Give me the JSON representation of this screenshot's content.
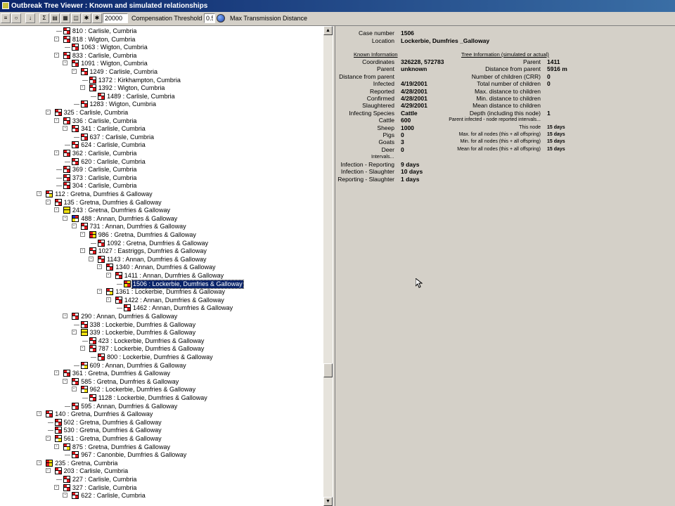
{
  "window": {
    "title": "Outbreak Tree Viewer : Known and simulated relationships"
  },
  "toolbar": {
    "distance_value": "20000",
    "comp_label": "Compensation Threshold",
    "comp_value": "0.5",
    "max_label": "Max Transmission Distance",
    "icons": [
      "tree-view-icon",
      "refresh-icon",
      "sort-icon",
      "sigma-icon",
      "chart-icon",
      "export-icon",
      "map-icon",
      "group-icon",
      "group-icon",
      "group-icon"
    ]
  },
  "colors": {
    "red": "#e0191f",
    "yellow": "#f0e010",
    "blue": "#1a33c8",
    "white": "#ffffff",
    "selection": "#0a246a"
  },
  "tree": [
    {
      "depth": 3,
      "toggle": "",
      "icon": "rwwr",
      "label": "810 : Carlisle, Cumbria"
    },
    {
      "depth": 3,
      "toggle": "-",
      "icon": "rwwr",
      "label": "818 : Wigton, Cumbria"
    },
    {
      "depth": 4,
      "toggle": "",
      "icon": "rwwr",
      "label": "1063 : Wigton, Cumbria"
    },
    {
      "depth": 3,
      "toggle": "-",
      "icon": "rwwr",
      "label": "833 : Carlisle, Cumbria"
    },
    {
      "depth": 4,
      "toggle": "-",
      "icon": "rwwr",
      "label": "1091 : Wigton, Cumbria"
    },
    {
      "depth": 5,
      "toggle": "-",
      "icon": "rwwr",
      "label": "1249 : Carlisle, Cumbria"
    },
    {
      "depth": 6,
      "toggle": "",
      "icon": "rwwr",
      "label": "1372 : Kirkhampton, Cumbria"
    },
    {
      "depth": 6,
      "toggle": "-",
      "icon": "rwwr",
      "label": "1392 : Wigton, Cumbria"
    },
    {
      "depth": 7,
      "toggle": "",
      "icon": "rwwr",
      "label": "1489 : Carlisle, Cumbria"
    },
    {
      "depth": 5,
      "toggle": "",
      "icon": "rwwr",
      "label": "1283 : Wigton, Cumbria"
    },
    {
      "depth": 2,
      "toggle": "-",
      "icon": "rwwr",
      "label": "325 : Carlisle, Cumbria"
    },
    {
      "depth": 3,
      "toggle": "-",
      "icon": "rwwr",
      "label": "336 : Carlisle, Cumbria"
    },
    {
      "depth": 4,
      "toggle": "-",
      "icon": "rwwr",
      "label": "341 : Carlisle, Cumbria"
    },
    {
      "depth": 5,
      "toggle": "",
      "icon": "rwwr",
      "label": "637 : Carlisle, Cumbria"
    },
    {
      "depth": 4,
      "toggle": "",
      "icon": "rwwr",
      "label": "624 : Carlisle, Cumbria"
    },
    {
      "depth": 3,
      "toggle": "-",
      "icon": "rwwr",
      "label": "362 : Carlisle, Cumbria"
    },
    {
      "depth": 4,
      "toggle": "",
      "icon": "rwwr",
      "label": "620 : Carlisle, Cumbria"
    },
    {
      "depth": 3,
      "toggle": "",
      "icon": "rwwr",
      "label": "369 : Carlisle, Cumbria"
    },
    {
      "depth": 3,
      "toggle": "",
      "icon": "rwwr",
      "label": "373 : Carlisle, Cumbria"
    },
    {
      "depth": 3,
      "toggle": "",
      "icon": "rwwr",
      "label": "304 : Carlisle, Cumbria"
    },
    {
      "depth": 1,
      "toggle": "-",
      "icon": "rwwy",
      "label": "112 : Gretna, Dumfries & Galloway"
    },
    {
      "depth": 2,
      "toggle": "-",
      "icon": "rwwr",
      "label": "135 : Gretna, Dumfries & Galloway"
    },
    {
      "depth": 3,
      "toggle": "-",
      "icon": "yyyy",
      "label": "243 : Gretna, Dumfries & Galloway"
    },
    {
      "depth": 4,
      "toggle": "-",
      "icon": "bryw",
      "label": "488 : Annan, Dumfries & Galloway"
    },
    {
      "depth": 5,
      "toggle": "-",
      "icon": "rwwr",
      "label": "731 : Annan, Dumfries & Galloway"
    },
    {
      "depth": 6,
      "toggle": "-",
      "icon": "ryry",
      "label": "986 : Gretna, Dumfries & Galloway"
    },
    {
      "depth": 7,
      "toggle": "",
      "icon": "rwwr",
      "label": "1092 : Gretna, Dumfries & Galloway"
    },
    {
      "depth": 6,
      "toggle": "-",
      "icon": "rwwr",
      "label": "1027 : Eastriggs, Dumfries & Galloway"
    },
    {
      "depth": 7,
      "toggle": "-",
      "icon": "rwwr",
      "label": "1143 : Annan, Dumfries & Galloway"
    },
    {
      "depth": 8,
      "toggle": "-",
      "icon": "rwwr",
      "label": "1340 : Annan, Dumfries & Galloway"
    },
    {
      "depth": 9,
      "toggle": "-",
      "icon": "rwwr",
      "label": "1411 : Annan, Dumfries & Galloway"
    },
    {
      "depth": 10,
      "toggle": "",
      "icon": "ryyr",
      "label": "1506 : Lockerbie, Dumfries & Galloway",
      "selected": true
    },
    {
      "depth": 8,
      "toggle": "-",
      "icon": "rwwy",
      "label": "1361 : Lockerbie, Dumfries & Galloway"
    },
    {
      "depth": 9,
      "toggle": "-",
      "icon": "rwwr",
      "label": "1422 : Annan, Dumfries & Galloway"
    },
    {
      "depth": 10,
      "toggle": "",
      "icon": "rwwr",
      "label": "1462 : Annan, Dumfries & Galloway"
    },
    {
      "depth": 4,
      "toggle": "-",
      "icon": "rwwr",
      "label": "290 : Annan, Dumfries & Galloway"
    },
    {
      "depth": 5,
      "toggle": "",
      "icon": "rwwr",
      "label": "338 : Lockerbie, Dumfries & Galloway"
    },
    {
      "depth": 5,
      "toggle": "-",
      "icon": "yyyy",
      "label": "339 : Lockerbie, Dumfries & Galloway"
    },
    {
      "depth": 6,
      "toggle": "",
      "icon": "rwwr",
      "label": "423 : Lockerbie, Dumfries & Galloway"
    },
    {
      "depth": 6,
      "toggle": "-",
      "icon": "rwwr",
      "label": "787 : Lockerbie, Dumfries & Galloway"
    },
    {
      "depth": 7,
      "toggle": "",
      "icon": "rwwr",
      "label": "800 : Lockerbie, Dumfries & Galloway"
    },
    {
      "depth": 5,
      "toggle": "",
      "icon": "rwwy",
      "label": "609 : Annan, Dumfries & Galloway"
    },
    {
      "depth": 3,
      "toggle": "-",
      "icon": "rwwr",
      "label": "361 : Gretna, Dumfries & Galloway"
    },
    {
      "depth": 4,
      "toggle": "-",
      "icon": "rwwr",
      "label": "585 : Gretna, Dumfries & Galloway"
    },
    {
      "depth": 5,
      "toggle": "-",
      "icon": "rwwy",
      "label": "962 : Lockerbie, Dumfries & Galloway"
    },
    {
      "depth": 6,
      "toggle": "",
      "icon": "rwwr",
      "label": "1128 : Lockerbie, Dumfries & Galloway"
    },
    {
      "depth": 4,
      "toggle": "",
      "icon": "rwwr",
      "label": "595 : Annan, Dumfries & Galloway"
    },
    {
      "depth": 1,
      "toggle": "-",
      "icon": "rwwr",
      "label": "140 : Gretna, Dumfries & Galloway"
    },
    {
      "depth": 2,
      "toggle": "",
      "icon": "rwwr",
      "label": "502 : Gretna, Dumfries & Galloway"
    },
    {
      "depth": 2,
      "toggle": "",
      "icon": "rwwr",
      "label": "530 : Gretna, Dumfries & Galloway"
    },
    {
      "depth": 2,
      "toggle": "-",
      "icon": "rwwy",
      "label": "561 : Gretna, Dumfries & Galloway"
    },
    {
      "depth": 3,
      "toggle": "-",
      "icon": "rwwy",
      "label": "875 : Gretna, Dumfries & Galloway"
    },
    {
      "depth": 4,
      "toggle": "",
      "icon": "rwwr",
      "label": "967 : Canonbie, Dumfries & Galloway"
    },
    {
      "depth": 1,
      "toggle": "-",
      "icon": "ryry",
      "label": "235 : Gretna, Cumbria"
    },
    {
      "depth": 2,
      "toggle": "-",
      "icon": "rwwr",
      "label": "203 : Carlisle, Cumbria"
    },
    {
      "depth": 3,
      "toggle": "",
      "icon": "rwwr",
      "label": "227 : Carlisle, Cumbria"
    },
    {
      "depth": 3,
      "toggle": "-",
      "icon": "rwwr",
      "label": "327 : Carlisle, Cumbria"
    },
    {
      "depth": 4,
      "toggle": "-",
      "icon": "rwwr",
      "label": "622 : Carlisle, Cumbria"
    }
  ],
  "info": {
    "case_number": {
      "label": "Case number",
      "value": "1506"
    },
    "location": {
      "label": "Location",
      "value": "Lockerbie, Dumfries _Galloway"
    },
    "known_header": "Known Information",
    "tree_header": "Tree Information (simulated or actual)",
    "known": [
      {
        "label": "Coordinates",
        "value": "326228, 572783"
      },
      {
        "label": "Parent",
        "value": "unknown"
      },
      {
        "label": "Distance from parent",
        "value": ""
      },
      {
        "label": "Infected",
        "value": "4/19/2001"
      },
      {
        "label": "Reported",
        "value": "4/28/2001"
      },
      {
        "label": "Confirmed",
        "value": "4/28/2001"
      },
      {
        "label": "Slaughtered",
        "value": "4/29/2001"
      },
      {
        "label": "Infecting Species",
        "value": "Cattle"
      },
      {
        "label": "Cattle",
        "value": "600"
      },
      {
        "label": "Sheep",
        "value": "1000"
      },
      {
        "label": "Pigs",
        "value": "0"
      },
      {
        "label": "Goats",
        "value": "3"
      },
      {
        "label": "Deer",
        "value": "0"
      }
    ],
    "tree_info": [
      {
        "label": "Parent",
        "value": "1411",
        "small": false
      },
      {
        "label": "Distance from parent",
        "value": "5916 m",
        "small": false
      },
      {
        "label": "Number of children (CRR)",
        "value": "0",
        "small": false
      },
      {
        "label": "Total number of children",
        "value": "0",
        "small": false
      },
      {
        "label": "Max. distance to children",
        "value": "",
        "small": false
      },
      {
        "label": "Min. distance to children",
        "value": "",
        "small": false
      },
      {
        "label": "Mean distance to children",
        "value": "",
        "small": false
      },
      {
        "label": "Depth (including this node)",
        "value": "1",
        "small": false
      },
      {
        "label": "Parent infected - node reported intervals...",
        "value": "",
        "small": true
      },
      {
        "label": "This node",
        "value": "15 days",
        "small": true
      },
      {
        "label": "Max. for all nodes (this + all offspring)",
        "value": "15 days",
        "small": true
      },
      {
        "label": "Min. for all nodes (this + all offspring)",
        "value": "15 days",
        "small": true
      },
      {
        "label": "Mean for all nodes (this + all offspring)",
        "value": "15 days",
        "small": true
      }
    ],
    "intervals_header": "Intervals...",
    "intervals": [
      {
        "label": "Infection - Reporting",
        "value": "9 days"
      },
      {
        "label": "Infection - Slaughter",
        "value": "10 days"
      },
      {
        "label": "Reporting - Slaughter",
        "value": "1 days"
      }
    ]
  }
}
